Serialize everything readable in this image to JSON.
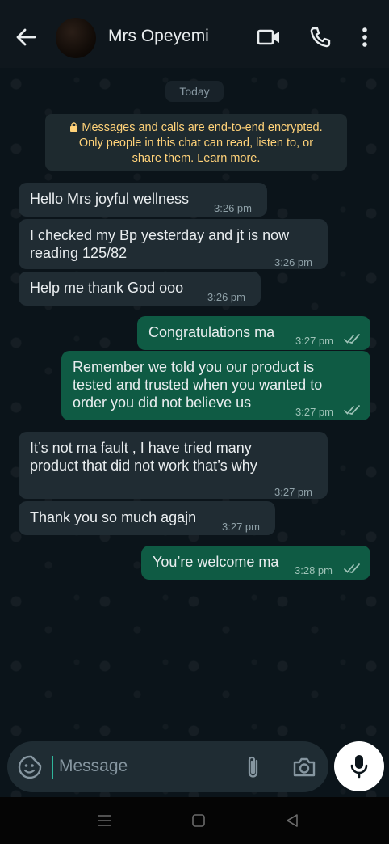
{
  "header": {
    "contact_name": "Mrs Opeyemi"
  },
  "chat": {
    "date_chip": "Today",
    "encryption_notice": [
      "Messages and calls are end-to-end encrypted.",
      "Only people in this chat can read, listen to, or",
      "share them. Learn more."
    ],
    "messages": [
      {
        "direction": "in",
        "lines": [
          "Hello Mrs joyful wellness"
        ],
        "time": "3:26 pm"
      },
      {
        "direction": "in",
        "lines": [
          "I checked my Bp yesterday and jt is now",
          "reading 125/82"
        ],
        "time": "3:26 pm"
      },
      {
        "direction": "in",
        "lines": [
          "Help me thank God ooo"
        ],
        "time": "3:26 pm"
      },
      {
        "direction": "out",
        "lines": [
          "Congratulations ma"
        ],
        "time": "3:27 pm",
        "status": "read"
      },
      {
        "direction": "out",
        "lines": [
          "Remember we told you our product is",
          "tested and trusted when you wanted to",
          "order you did not believe us"
        ],
        "time": "3:27 pm",
        "status": "read"
      },
      {
        "direction": "in",
        "lines": [
          "It’s not ma fault , I have tried many",
          "product that did not work that’s why"
        ],
        "time": "3:27 pm"
      },
      {
        "direction": "in",
        "lines": [
          "Thank you so much agajn"
        ],
        "time": "3:27 pm"
      },
      {
        "direction": "out",
        "lines": [
          "You’re welcome ma"
        ],
        "time": "3:28 pm",
        "status": "read"
      }
    ]
  },
  "composer": {
    "placeholder": "Message"
  },
  "icons": {
    "back": "arrow-left-icon",
    "video": "video-camera-icon",
    "call": "phone-icon",
    "menu": "more-vertical-icon",
    "emoji": "sticker-smiley-icon",
    "attach": "paperclip-icon",
    "camera": "camera-icon",
    "mic": "microphone-icon",
    "read_receipt": "double-check-icon"
  },
  "colors": {
    "incoming_bubble": "#202c33",
    "outgoing_bubble": "#0f5b44",
    "encryption_text": "#ffd279",
    "background": "#0b141a"
  }
}
